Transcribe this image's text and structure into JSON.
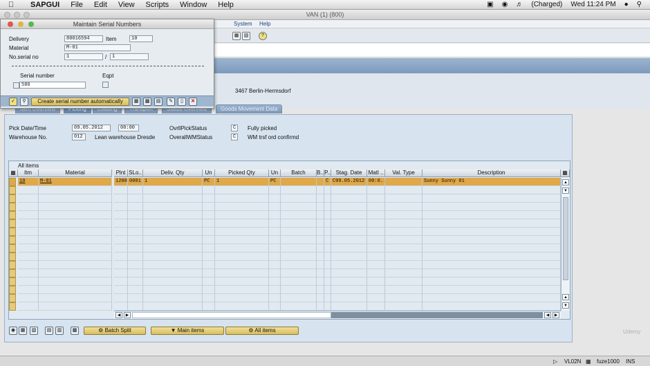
{
  "mac_menubar": {
    "app": "SAPGUI",
    "items": [
      "File",
      "Edit",
      "View",
      "Scripts",
      "Window",
      "Help"
    ],
    "status": {
      "battery": "(Charged)",
      "clock": "Wed 11:24 PM"
    }
  },
  "window": {
    "title": "VAN (1) (800)"
  },
  "sap_menu": {
    "system": "System",
    "help": "Help"
  },
  "header": {
    "address": "3467 Berlin-Hermsdorf"
  },
  "tabs": [
    {
      "label": "Item Overview"
    },
    {
      "label": "Picking"
    },
    {
      "label": "Loading"
    },
    {
      "label": "Transport"
    },
    {
      "label": "Status Overview"
    },
    {
      "label": "Goods Movement Data"
    }
  ],
  "picking": {
    "pick_date_label": "Pick Date/Time",
    "pick_date": "09.05.2012",
    "pick_time": "00:00",
    "ovrl_pick_status_label": "OvrllPickStatus",
    "ovrl_pick_status_code": "C",
    "ovrl_pick_status_text": "Fully picked",
    "warehouse_label": "Warehouse No.",
    "warehouse_no": "012",
    "warehouse_name": "Lean warehouse Dresde",
    "overall_wm_label": "OverallWMStatus",
    "overall_wm_code": "C",
    "overall_wm_text": "WM trsf ord confirmd"
  },
  "grid": {
    "title": "All items",
    "columns": [
      "Itm",
      "Material",
      "Plnt",
      "SLo..",
      "Deliv. Qty",
      "Un",
      "Picked Qty",
      "Un",
      "Batch",
      "B..",
      "P..",
      "Stag. Date",
      "Matl ..",
      "Val. Type",
      "Description"
    ],
    "rows": [
      {
        "itm": "10",
        "material": "M-01",
        "plnt": "1200",
        "slo": "0001",
        "deliv_qty": "1",
        "un": "PC",
        "picked_qty": "1",
        "un2": "PC",
        "batch": "",
        "b": "",
        "p": "C",
        "stag_date": "C09.05.2012",
        "matl": "00:0..",
        "val_type": "",
        "description": "Sunny Sunny 01"
      }
    ]
  },
  "bottom_buttons": {
    "batch_split": "Batch Split",
    "main_items": "Main items",
    "all_items": "All items"
  },
  "dialog": {
    "title": "Maintain Serial Numbers",
    "delivery_label": "Delivery",
    "delivery": "80016594",
    "item_label": "Item",
    "item": "10",
    "material_label": "Material",
    "material": "M-01",
    "no_serial_label": "No.serial no",
    "no_serial_current": "1",
    "no_serial_sep": "/",
    "no_serial_total": "1",
    "serial_header": "Serial number",
    "eqpt_header": "Eqpt",
    "serial_value": "580",
    "create_auto_label": "Create serial number automatically"
  },
  "statusbar": {
    "tcode": "VL02N",
    "user": "fuze1000",
    "mode": "INS"
  },
  "watermark": "Udemy"
}
